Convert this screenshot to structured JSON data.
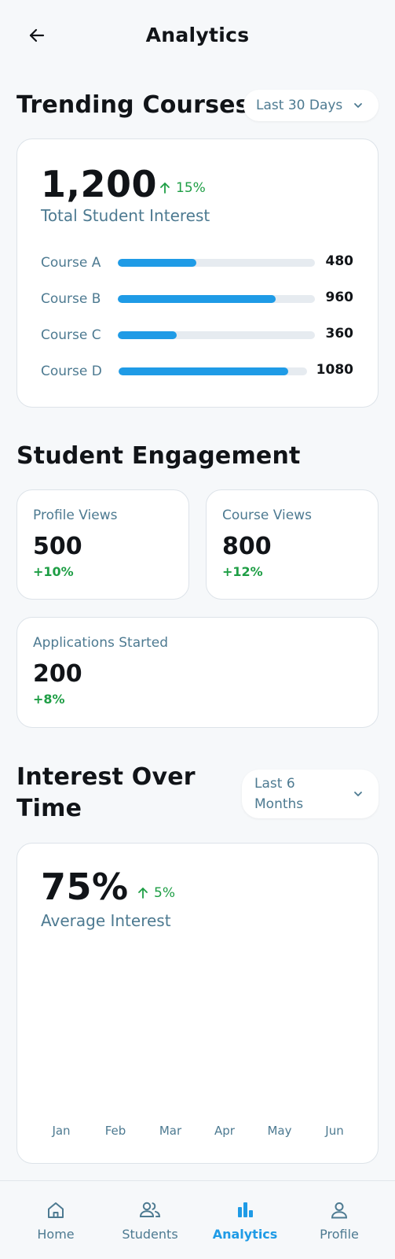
{
  "header": {
    "title": "Analytics"
  },
  "trending": {
    "title": "Trending Courses",
    "filter": "Last 30 Days",
    "total": "1,200",
    "trend": "15%",
    "subtitle": "Total Student Interest",
    "courses": [
      {
        "name": "Course A",
        "value": "480",
        "fill": 0.4
      },
      {
        "name": "Course B",
        "value": "960",
        "fill": 0.8
      },
      {
        "name": "Course C",
        "value": "360",
        "fill": 0.3
      },
      {
        "name": "Course D",
        "value": "1080",
        "fill": 0.9
      }
    ]
  },
  "engagement": {
    "title": "Student Engagement",
    "stats": [
      {
        "label": "Profile Views",
        "value": "500",
        "change": "+10%"
      },
      {
        "label": "Course Views",
        "value": "800",
        "change": "+12%"
      },
      {
        "label": "Applications Started",
        "value": "200",
        "change": "+8%"
      }
    ]
  },
  "interest": {
    "title_line1": "Interest Over",
    "title_line2": "Time",
    "filter_line1": "Last 6",
    "filter_line2": "Months",
    "value": "75%",
    "trend": "5%",
    "subtitle": "Average Interest",
    "months": [
      "Jan",
      "Feb",
      "Mar",
      "Apr",
      "May",
      "Jun"
    ]
  },
  "nav": {
    "items": [
      {
        "label": "Home",
        "icon": "home-icon"
      },
      {
        "label": "Students",
        "icon": "students-icon"
      },
      {
        "label": "Analytics",
        "icon": "analytics-icon",
        "active": true
      },
      {
        "label": "Profile",
        "icon": "profile-icon"
      }
    ]
  },
  "colors": {
    "accent": "#1f9be6",
    "positive": "#1e9e45",
    "muted": "#4d7a91",
    "track": "#e6ebf0"
  }
}
